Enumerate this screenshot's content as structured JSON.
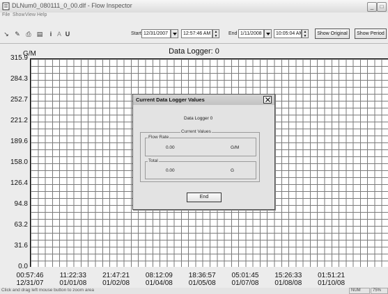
{
  "window": {
    "title": "DLNum0_080111_0_00.dlf - Flow Inspector",
    "minimize_glyph": "_",
    "maximize_glyph": "□"
  },
  "menu": [
    "File",
    "Show",
    "View",
    "Help"
  ],
  "toolbar": {
    "icons": [
      "cursor-icon",
      "open-icon",
      "print-icon",
      "copy-icon",
      "info-icon",
      "a-icon",
      "u-icon"
    ],
    "icon_glyphs": [
      "↘",
      "✎",
      "⎙",
      "▤",
      "i",
      "A",
      "U"
    ],
    "start_label": "Start",
    "start_date": "12/31/2007",
    "start_time": "12:57:46 AM",
    "end_label": "End",
    "end_date": "1/11/2008",
    "end_time": "10:05:04 AM",
    "show_original_label": "Show Original",
    "show_period_label": "Show Period"
  },
  "chart_data": {
    "type": "line",
    "title": "Data Logger: 0",
    "ylabel": "G/M",
    "ylim": [
      0.0,
      315.9
    ],
    "yticks": [
      "315.9",
      "284.3",
      "252.7",
      "221.2",
      "189.6",
      "158.0",
      "126.4",
      "94.8",
      "63.2",
      "31.6",
      "0.0"
    ],
    "xticks": [
      {
        "time": "00:57:46",
        "date": "12/31/07"
      },
      {
        "time": "11:22:33",
        "date": "01/01/08"
      },
      {
        "time": "21:47:21",
        "date": "01/02/08"
      },
      {
        "time": "08:12:09",
        "date": "01/04/08"
      },
      {
        "time": "18:36:57",
        "date": "01/05/08"
      },
      {
        "time": "05:01:45",
        "date": "01/07/08"
      },
      {
        "time": "15:26:33",
        "date": "01/08/08"
      },
      {
        "time": "01:51:21",
        "date": "01/10/08"
      }
    ],
    "series": [],
    "grid": true
  },
  "dialog": {
    "title": "Current Data Logger Values",
    "logger_label": "Data Logger 0",
    "group_title": "Current Values",
    "flow_rate": {
      "label": "Flow Rate",
      "value": "0.00",
      "unit": "G/M"
    },
    "total": {
      "label": "Total",
      "value": "0.00",
      "unit": "G"
    },
    "end_button": "End"
  },
  "status": {
    "text": "Click and drag left mouse button to zoom area",
    "num": "NUM",
    "percent": "75%"
  }
}
